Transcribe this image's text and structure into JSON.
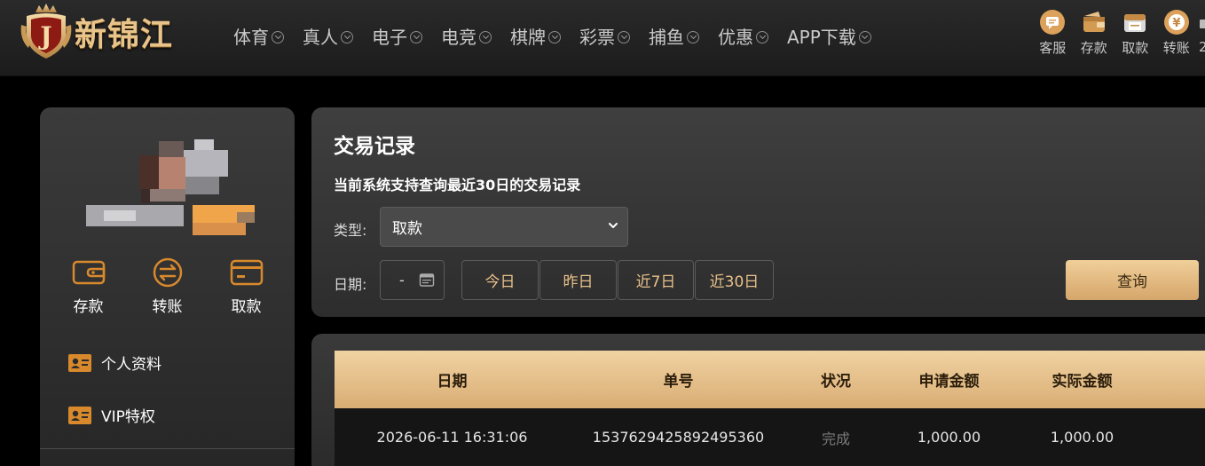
{
  "brand": {
    "name": "新锦江",
    "badge_letter": "J"
  },
  "nav": [
    {
      "label": "体育"
    },
    {
      "label": "真人"
    },
    {
      "label": "电子"
    },
    {
      "label": "电竞"
    },
    {
      "label": "棋牌"
    },
    {
      "label": "彩票"
    },
    {
      "label": "捕鱼"
    },
    {
      "label": "优惠"
    },
    {
      "label": "APP下载"
    }
  ],
  "quick_actions": [
    {
      "label": "客服",
      "icon": "chat-icon"
    },
    {
      "label": "存款",
      "icon": "wallet-icon"
    },
    {
      "label": "取款",
      "icon": "cash-icon"
    },
    {
      "label": "转账",
      "icon": "yuan-coin-icon"
    }
  ],
  "quick_more_label": "2",
  "sidebar": {
    "actions": [
      {
        "label": "存款",
        "icon": "wallet-icon"
      },
      {
        "label": "转账",
        "icon": "transfer-icon"
      },
      {
        "label": "取款",
        "icon": "card-icon"
      }
    ],
    "menu": [
      {
        "label": "个人资料",
        "icon": "id-card-icon"
      },
      {
        "label": "VIP特权",
        "icon": "id-card-icon"
      }
    ]
  },
  "panel": {
    "title": "交易记录",
    "description": "当前系统支持查询最近30日的交易记录",
    "type_label": "类型:",
    "type_value": "取款",
    "date_label": "日期:",
    "date_value": "-",
    "ranges": [
      {
        "label": "今日"
      },
      {
        "label": "昨日"
      },
      {
        "label": "近7日"
      },
      {
        "label": "近30日"
      }
    ],
    "query_label": "查询"
  },
  "table": {
    "headers": [
      "日期",
      "单号",
      "状况",
      "申请金额",
      "实际金额"
    ],
    "rows": [
      {
        "date": "2026-06-11 16:31:06",
        "order_no": "1537629425892495360",
        "status": "完成",
        "requested": "1,000.00",
        "actual": "1,000.00"
      }
    ]
  },
  "colors": {
    "accent_gold": "#e8c08a",
    "header_gold_start": "#f0d2a2",
    "header_gold_end": "#d9ad74",
    "icon_orange": "#d8892c"
  }
}
